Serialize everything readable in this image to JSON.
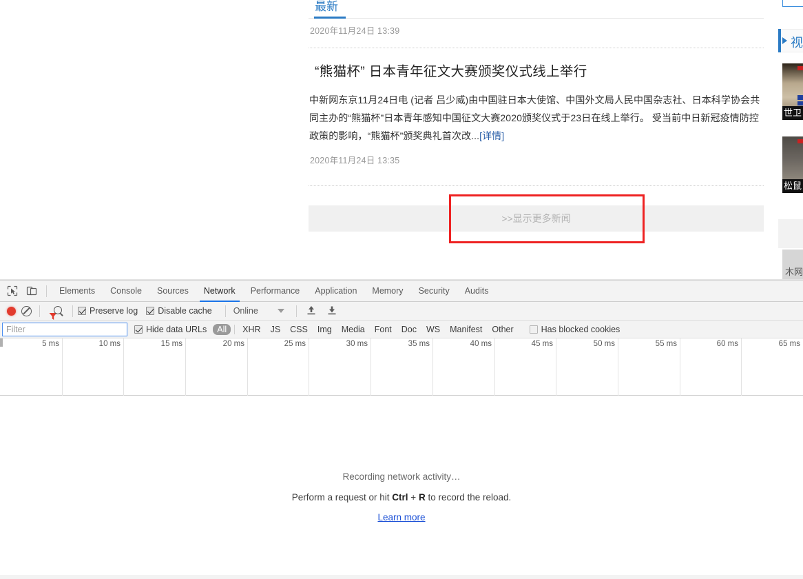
{
  "page": {
    "tab": {
      "label": "最新"
    },
    "entries": [
      {
        "timestamp": "2020年11月24日 13:39"
      },
      {
        "title": "“熊猫杯” 日本青年征文大赛颁奖仪式线上举行",
        "body": "中新网东京11月24日电 (记者 吕少威)由中国驻日本大使馆、中国外文局人民中国杂志社、日本科学协会共同主办的“熊猫杯”日本青年感知中国征文大赛2020颁奖仪式于23日在线上举行。 受当前中日新冠疫情防控政策的影响，“熊猫杯”颁奖典礼首次改...",
        "detail_link": "[详情]",
        "timestamp": "2020年11月24日 13:35"
      }
    ],
    "more_button": {
      "label": ">>显示更多新闻"
    },
    "right_rail": {
      "section_title": "视",
      "thumbs": [
        {
          "caption": "世卫"
        },
        {
          "caption": "松鼠"
        }
      ],
      "bottom_text": "木网"
    }
  },
  "devtools": {
    "icons": {
      "inspect": "inspect-element-icon",
      "device": "device-toolbar-icon",
      "record": "record-icon",
      "clear": "clear-icon",
      "filter": "filter-funnel-icon",
      "search": "search-icon",
      "import": "import-har-icon",
      "export": "export-har-icon"
    },
    "tabs": [
      {
        "label": "Elements",
        "active": false
      },
      {
        "label": "Console",
        "active": false
      },
      {
        "label": "Sources",
        "active": false
      },
      {
        "label": "Network",
        "active": true
      },
      {
        "label": "Performance",
        "active": false
      },
      {
        "label": "Application",
        "active": false
      },
      {
        "label": "Memory",
        "active": false
      },
      {
        "label": "Security",
        "active": false
      },
      {
        "label": "Audits",
        "active": false
      }
    ],
    "toolbar": {
      "preserve_log": {
        "label": "Preserve log",
        "checked": true
      },
      "disable_cache": {
        "label": "Disable cache",
        "checked": true
      },
      "throttling": {
        "value": "Online"
      }
    },
    "filterbar": {
      "filter_placeholder": "Filter",
      "filter_value": "",
      "hide_data_urls": {
        "label": "Hide data URLs",
        "checked": true
      },
      "types": [
        "All",
        "XHR",
        "JS",
        "CSS",
        "Img",
        "Media",
        "Font",
        "Doc",
        "WS",
        "Manifest",
        "Other"
      ],
      "selected_type": "All",
      "has_blocked_cookies": {
        "label": "Has blocked cookies",
        "checked": false
      }
    },
    "timeline": {
      "ticks": [
        "5 ms",
        "10 ms",
        "15 ms",
        "20 ms",
        "25 ms",
        "30 ms",
        "35 ms",
        "40 ms",
        "45 ms",
        "50 ms",
        "55 ms",
        "60 ms",
        "65 ms"
      ]
    },
    "empty_state": {
      "line1": "Recording network activity…",
      "line2_pre": "Perform a request or hit ",
      "line2_key1": "Ctrl",
      "line2_plus": " + ",
      "line2_key2": "R",
      "line2_post": " to record the reload.",
      "learn_more": "Learn more"
    }
  },
  "colors": {
    "accent_blue": "#1a73e8",
    "link_blue": "#2b7bc4",
    "highlight_red": "#ee2222",
    "record_red": "#e23b2e"
  }
}
